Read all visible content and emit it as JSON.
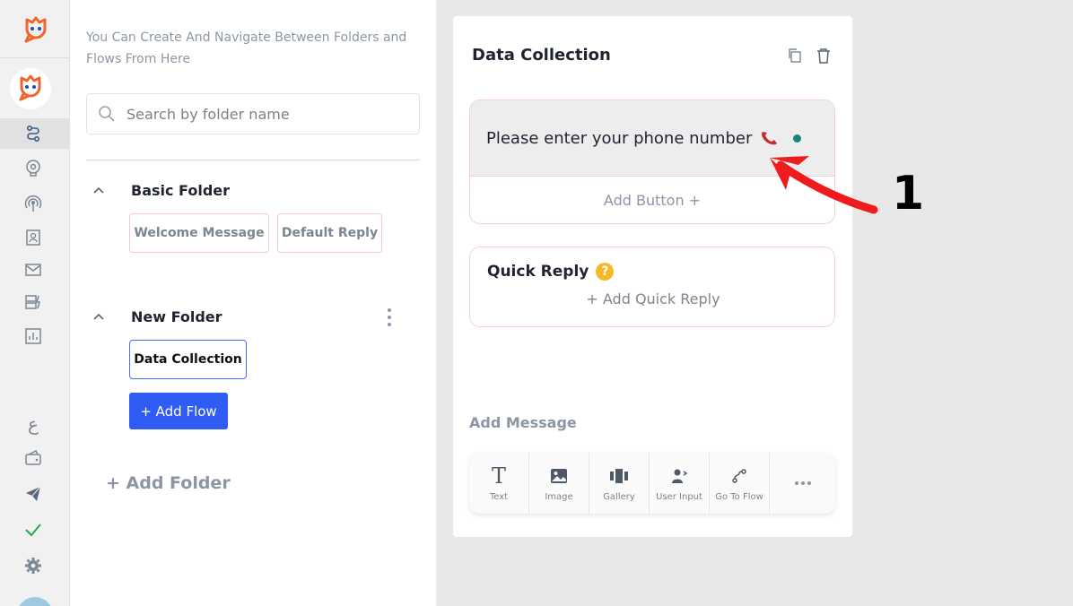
{
  "sidebar": {
    "logo_icon": "bot-logo-icon",
    "avatar_icon": "bot-avatar-icon",
    "icons": [
      "flows-icon",
      "bot-brain-icon",
      "broadcast-icon",
      "contacts-icon",
      "mail-icon",
      "automation-icon",
      "analytics-icon",
      "language-icon",
      "wallet-icon",
      "telegram-icon",
      "check-icon",
      "settings-icon"
    ],
    "brand_color": "#f2652a",
    "check_color": "#22a857"
  },
  "folders_panel": {
    "hint": "You Can Create And Navigate Between Folders and Flows From Here",
    "search_placeholder": "Search by folder name",
    "folders": [
      {
        "name": "Basic Folder",
        "flows": [
          "Welcome Message",
          "Default Reply"
        ]
      },
      {
        "name": "New Folder",
        "flows": [
          "Data Collection"
        ]
      }
    ],
    "add_flow_label": "+ Add Flow",
    "add_folder_label": "+ Add Folder"
  },
  "flow_card": {
    "title": "Data Collection",
    "message_text": "Please enter your phone number",
    "message_emoji": "telephone-receiver-icon",
    "add_button_label": "Add Button +",
    "quick_reply_title": "Quick Reply",
    "quick_reply_help": "?",
    "add_quick_reply_label": "+ Add Quick Reply",
    "add_message_label": "Add Message",
    "tools": [
      {
        "label": "Text",
        "icon": "text-icon"
      },
      {
        "label": "Image",
        "icon": "image-icon"
      },
      {
        "label": "Gallery",
        "icon": "gallery-icon"
      },
      {
        "label": "User Input",
        "icon": "user-input-icon"
      },
      {
        "label": "Go To Flow",
        "icon": "go-to-flow-icon"
      },
      {
        "label": "",
        "icon": "more-icon"
      }
    ]
  },
  "annotation": {
    "step_number": "1",
    "arrow_color": "#ee1c1c"
  },
  "colors": {
    "primary": "#2f5cf4",
    "panel_bg": "#ffffff",
    "canvas_bg": "#e8e8e8",
    "chip_border": "#f3c6d7"
  }
}
